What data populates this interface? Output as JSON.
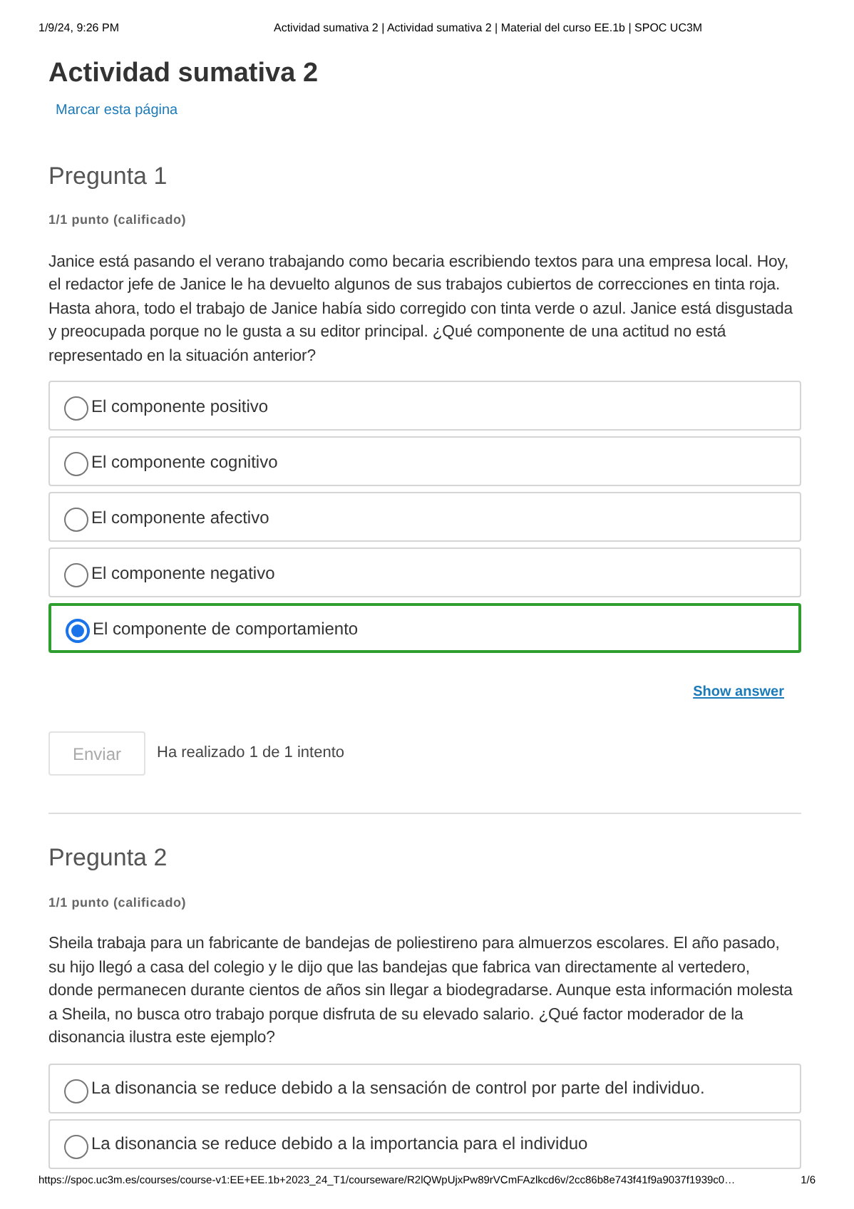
{
  "print_header": {
    "date": "1/9/24, 9:26 PM",
    "title": "Actividad sumativa 2 | Actividad sumativa 2 | Material del curso EE.1b | SPOC UC3M"
  },
  "page_title": "Actividad sumativa 2",
  "bookmark_link": "Marcar esta página",
  "questions": [
    {
      "title": "Pregunta 1",
      "points": "1/1 punto (calificado)",
      "prompt": "Janice está pasando el verano trabajando como becaria escribiendo textos para una empresa local. Hoy, el redactor jefe de Janice le ha devuelto algunos de sus trabajos cubiertos de correcciones en tinta roja. Hasta ahora, todo el trabajo de Janice había sido corregido con tinta verde o azul. Janice está disgustada y preocupada porque no le gusta a su editor principal. ¿Qué componente de una actitud no está representado en la situación anterior?",
      "options": [
        {
          "label": "El componente positivo",
          "selected": false
        },
        {
          "label": "El componente cognitivo",
          "selected": false
        },
        {
          "label": "El componente afectivo",
          "selected": false
        },
        {
          "label": "El componente negativo",
          "selected": false
        },
        {
          "label": "El componente de comportamiento",
          "selected": true
        }
      ],
      "show_answer": "Show answer",
      "submit_button": {
        "label": "Enviar",
        "disabled": true
      },
      "attempts": "Ha realizado 1 de 1 intento"
    },
    {
      "title": "Pregunta 2",
      "points": "1/1 punto (calificado)",
      "prompt": "Sheila trabaja para un fabricante de bandejas de poliestireno para almuerzos escolares. El año pasado, su hijo llegó a casa del colegio y le dijo que las bandejas que fabrica van directamente al vertedero, donde permanecen durante cientos de años sin llegar a biodegradarse. Aunque esta información molesta a Sheila, no busca otro trabajo porque disfruta de su elevado salario. ¿Qué factor moderador de la disonancia ilustra este ejemplo?",
      "options": [
        {
          "label": "La disonancia se reduce debido a la sensación de control por parte del individuo.",
          "selected": false
        },
        {
          "label": "La disonancia se reduce debido a la importancia para el individuo",
          "selected": false
        }
      ]
    }
  ],
  "print_footer": {
    "url": "https://spoc.uc3m.es/courses/course-v1:EE+EE.1b+2023_24_T1/courseware/R2lQWpUjxPw89rVCmFAzlkcd6v/2cc86b8e743f41f9a9037f1939c0…",
    "page": "1/6"
  }
}
